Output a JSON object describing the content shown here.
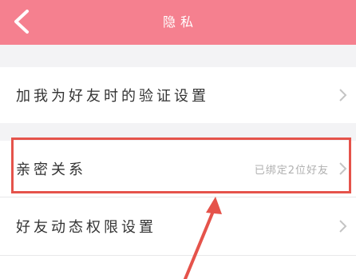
{
  "header": {
    "title": "隐私",
    "back_icon": "back-chevron-icon"
  },
  "settings": {
    "friend_verification": {
      "label": "加我为好友时的验证设置"
    },
    "intimate_relation": {
      "label": "亲密关系",
      "value": "已绑定2位好友"
    },
    "friend_feed_permission": {
      "label": "好友动态权限设置"
    }
  },
  "colors": {
    "header_bg": "#f5808f",
    "annotation": "#e5534b"
  }
}
